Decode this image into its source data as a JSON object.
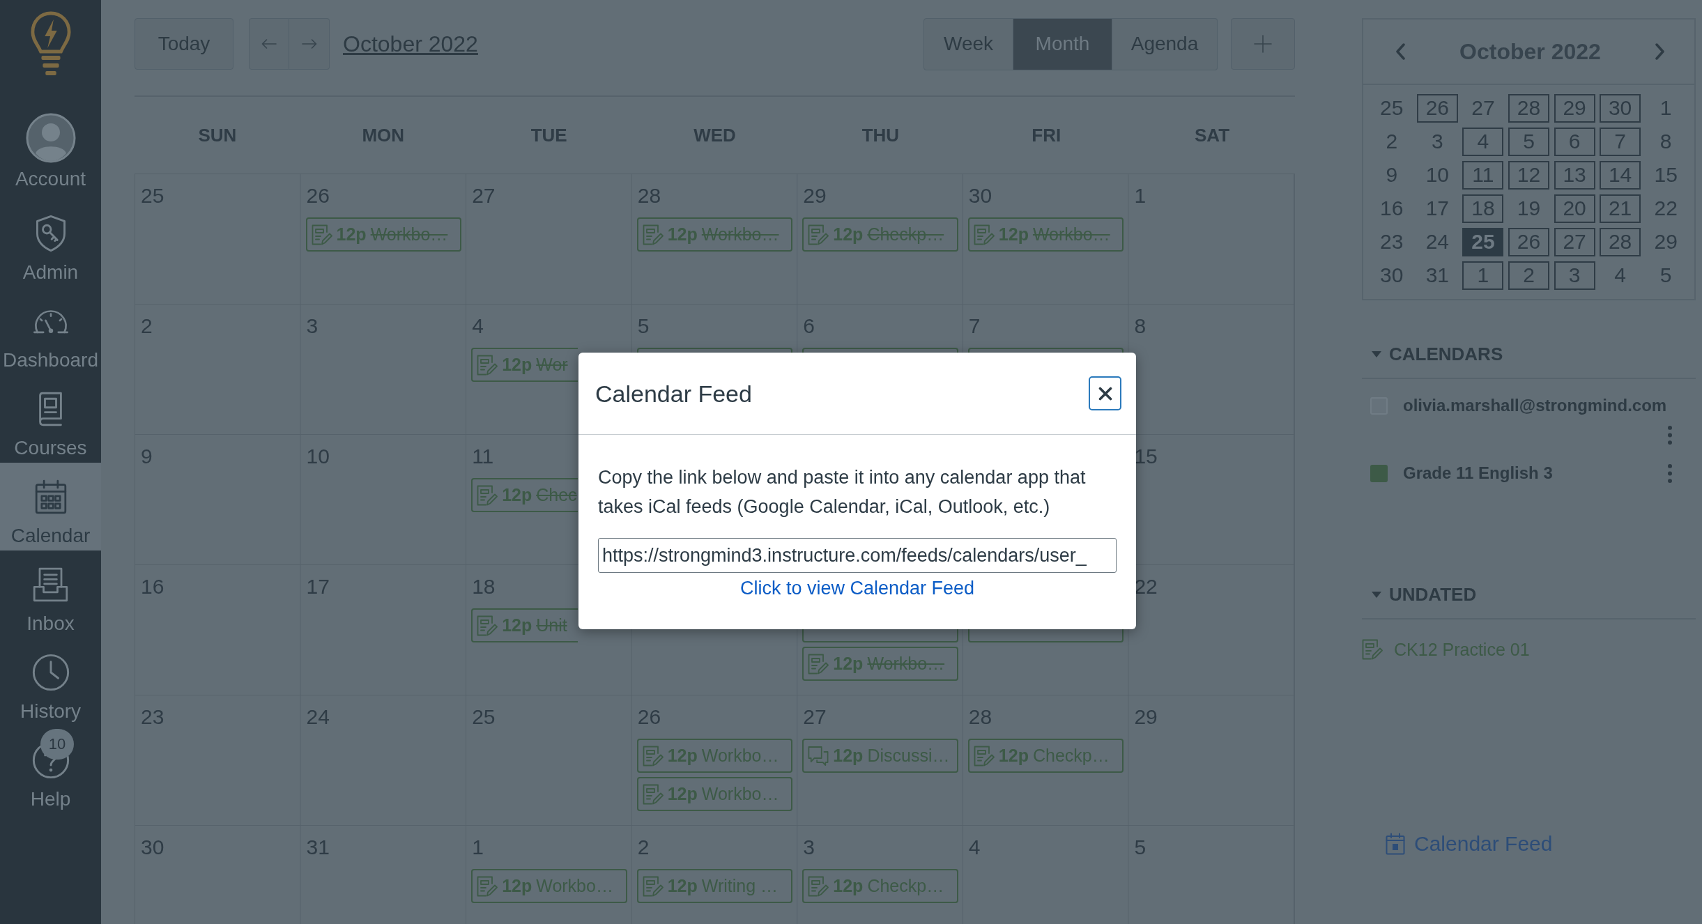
{
  "global_nav": {
    "items": [
      {
        "label": "Account",
        "selected": false
      },
      {
        "label": "Admin",
        "selected": false
      },
      {
        "label": "Dashboard",
        "selected": false
      },
      {
        "label": "Courses",
        "selected": false
      },
      {
        "label": "Calendar",
        "selected": true
      },
      {
        "label": "Inbox",
        "selected": false
      },
      {
        "label": "History",
        "selected": false
      },
      {
        "label": "Help",
        "selected": false,
        "badge": "10"
      }
    ]
  },
  "toolbar": {
    "today": "Today",
    "title": "October 2022",
    "views": [
      {
        "label": "Week",
        "selected": false
      },
      {
        "label": "Month",
        "selected": true
      },
      {
        "label": "Agenda",
        "selected": false
      }
    ]
  },
  "month": {
    "weekdays": [
      "SUN",
      "MON",
      "TUE",
      "WED",
      "THU",
      "FRI",
      "SAT"
    ],
    "weeks": [
      {
        "days": [
          {
            "kind": "date",
            "day": "25"
          },
          {
            "kind": "date",
            "day": "26",
            "events": [
              {
                "kind": "assignment",
                "time": "12p",
                "title": "Workbo…",
                "done": true
              }
            ]
          },
          {
            "kind": "date",
            "day": "27"
          },
          {
            "kind": "date",
            "day": "28",
            "events": [
              {
                "kind": "assignment",
                "time": "12p",
                "title": "Workbo…",
                "done": true
              }
            ]
          },
          {
            "kind": "date",
            "day": "29",
            "events": [
              {
                "kind": "assignment",
                "time": "12p",
                "title": "Checkp…",
                "done": true
              }
            ]
          },
          {
            "kind": "date",
            "day": "30",
            "events": [
              {
                "kind": "assignment",
                "time": "12p",
                "title": "Workbo…",
                "done": true
              }
            ]
          },
          {
            "kind": "date",
            "day": "1"
          }
        ]
      },
      {
        "days": [
          {
            "kind": "date",
            "day": "2"
          },
          {
            "kind": "date",
            "day": "3"
          },
          {
            "kind": "date",
            "day": "4",
            "events": [
              {
                "kind": "assignment",
                "time": "12p",
                "title": "Wor",
                "done": true
              }
            ]
          },
          {
            "kind": "date",
            "day": "5",
            "events": [
              {
                "kind": "covered"
              }
            ]
          },
          {
            "kind": "date",
            "day": "6",
            "events": [
              {
                "kind": "covered"
              }
            ]
          },
          {
            "kind": "date",
            "day": "7",
            "events": [
              {
                "kind": "covered"
              }
            ]
          },
          {
            "kind": "date",
            "day": "8"
          }
        ]
      },
      {
        "days": [
          {
            "kind": "date",
            "day": "9"
          },
          {
            "kind": "date",
            "day": "10"
          },
          {
            "kind": "date",
            "day": "11",
            "events": [
              {
                "kind": "assignment",
                "time": "12p",
                "title": "Chec",
                "done": true
              }
            ]
          },
          {
            "kind": "covered"
          },
          {
            "kind": "covered"
          },
          {
            "kind": "covered"
          },
          {
            "kind": "date",
            "day": "15"
          }
        ]
      },
      {
        "days": [
          {
            "kind": "date",
            "day": "16"
          },
          {
            "kind": "date",
            "day": "17"
          },
          {
            "kind": "date",
            "day": "18",
            "events": [
              {
                "kind": "assignment",
                "time": "12p",
                "title": "Unit",
                "done": true
              }
            ]
          },
          {
            "kind": "covered"
          },
          {
            "kind": "covered",
            "events": [
              {
                "kind": "covered"
              },
              {
                "kind": "assignment",
                "time": "12p",
                "title": "Workbo…",
                "done": true
              }
            ]
          },
          {
            "kind": "covered",
            "events": [
              {
                "kind": "covered"
              }
            ]
          },
          {
            "kind": "date",
            "day": "22"
          }
        ]
      },
      {
        "days": [
          {
            "kind": "date",
            "day": "23"
          },
          {
            "kind": "date",
            "day": "24"
          },
          {
            "kind": "date",
            "day": "25"
          },
          {
            "kind": "date",
            "day": "26",
            "events": [
              {
                "kind": "assignment",
                "time": "12p",
                "title": "Workbo…",
                "done": false
              },
              {
                "kind": "assignment",
                "time": "12p",
                "title": "Workbo…",
                "done": false
              }
            ]
          },
          {
            "kind": "date",
            "day": "27",
            "events": [
              {
                "kind": "discussion",
                "time": "12p",
                "title": "Discussi…",
                "done": false
              }
            ]
          },
          {
            "kind": "date",
            "day": "28",
            "events": [
              {
                "kind": "assignment",
                "time": "12p",
                "title": "Checkp…",
                "done": false
              }
            ]
          },
          {
            "kind": "date",
            "day": "29"
          }
        ]
      },
      {
        "days": [
          {
            "kind": "date",
            "day": "30"
          },
          {
            "kind": "date",
            "day": "31"
          },
          {
            "kind": "date",
            "day": "1",
            "events": [
              {
                "kind": "assignment",
                "time": "12p",
                "title": "Workbo…",
                "done": false
              }
            ]
          },
          {
            "kind": "date",
            "day": "2",
            "events": [
              {
                "kind": "assignment",
                "time": "12p",
                "title": "Writing …",
                "done": false
              }
            ]
          },
          {
            "kind": "date",
            "day": "3",
            "events": [
              {
                "kind": "assignment",
                "time": "12p",
                "title": "Checkp…",
                "done": false
              }
            ]
          },
          {
            "kind": "date",
            "day": "4"
          },
          {
            "kind": "date",
            "day": "5"
          }
        ]
      }
    ]
  },
  "mini_calendar": {
    "title": "October 2022",
    "weeks": [
      [
        {
          "day": "25",
          "has_events": false,
          "today": false
        },
        {
          "day": "26",
          "has_events": true,
          "today": false
        },
        {
          "day": "27",
          "has_events": false,
          "today": false
        },
        {
          "day": "28",
          "has_events": true,
          "today": false
        },
        {
          "day": "29",
          "has_events": true,
          "today": false
        },
        {
          "day": "30",
          "has_events": true,
          "today": false
        },
        {
          "day": "1",
          "has_events": false,
          "today": false
        }
      ],
      [
        {
          "day": "2",
          "has_events": false,
          "today": false
        },
        {
          "day": "3",
          "has_events": false,
          "today": false
        },
        {
          "day": "4",
          "has_events": true,
          "today": false
        },
        {
          "day": "5",
          "has_events": true,
          "today": false
        },
        {
          "day": "6",
          "has_events": true,
          "today": false
        },
        {
          "day": "7",
          "has_events": true,
          "today": false
        },
        {
          "day": "8",
          "has_events": false,
          "today": false
        }
      ],
      [
        {
          "day": "9",
          "has_events": false,
          "today": false
        },
        {
          "day": "10",
          "has_events": false,
          "today": false
        },
        {
          "day": "11",
          "has_events": true,
          "today": false
        },
        {
          "day": "12",
          "has_events": true,
          "today": false
        },
        {
          "day": "13",
          "has_events": true,
          "today": false
        },
        {
          "day": "14",
          "has_events": true,
          "today": false
        },
        {
          "day": "15",
          "has_events": false,
          "today": false
        }
      ],
      [
        {
          "day": "16",
          "has_events": false,
          "today": false
        },
        {
          "day": "17",
          "has_events": false,
          "today": false
        },
        {
          "day": "18",
          "has_events": true,
          "today": false
        },
        {
          "day": "19",
          "has_events": false,
          "today": false
        },
        {
          "day": "20",
          "has_events": true,
          "today": false
        },
        {
          "day": "21",
          "has_events": true,
          "today": false
        },
        {
          "day": "22",
          "has_events": false,
          "today": false
        }
      ],
      [
        {
          "day": "23",
          "has_events": false,
          "today": false
        },
        {
          "day": "24",
          "has_events": false,
          "today": false
        },
        {
          "day": "25",
          "has_events": false,
          "today": true
        },
        {
          "day": "26",
          "has_events": true,
          "today": false
        },
        {
          "day": "27",
          "has_events": true,
          "today": false
        },
        {
          "day": "28",
          "has_events": true,
          "today": false
        },
        {
          "day": "29",
          "has_events": false,
          "today": false
        }
      ],
      [
        {
          "day": "30",
          "has_events": false,
          "today": false
        },
        {
          "day": "31",
          "has_events": false,
          "today": false
        },
        {
          "day": "1",
          "has_events": true,
          "today": false
        },
        {
          "day": "2",
          "has_events": true,
          "today": false
        },
        {
          "day": "3",
          "has_events": true,
          "today": false
        },
        {
          "day": "4",
          "has_events": false,
          "today": false
        },
        {
          "day": "5",
          "has_events": false,
          "today": false
        }
      ]
    ]
  },
  "calendars": {
    "title": "CALENDARS",
    "expanded": true,
    "items": [
      {
        "name": "olivia.marshall@strongmind.com",
        "checked": false
      },
      {
        "name": "Grade 11 English 3",
        "checked": true,
        "color": "#3d5a47"
      }
    ]
  },
  "undated": {
    "title": "UNDATED",
    "expanded": true,
    "items": [
      {
        "kind": "assignment",
        "title": "CK12 Practice 01"
      }
    ]
  },
  "feed_link": {
    "label": "Calendar Feed"
  },
  "modal": {
    "title": "Calendar Feed",
    "message": "Copy the link below and paste it into any calendar app that takes iCal feeds (Google Calendar, iCal, Outlook, etc.)",
    "url": "https://strongmind3.instructure.com/feeds/calendars/user_",
    "link": "Click to view Calendar Feed"
  }
}
